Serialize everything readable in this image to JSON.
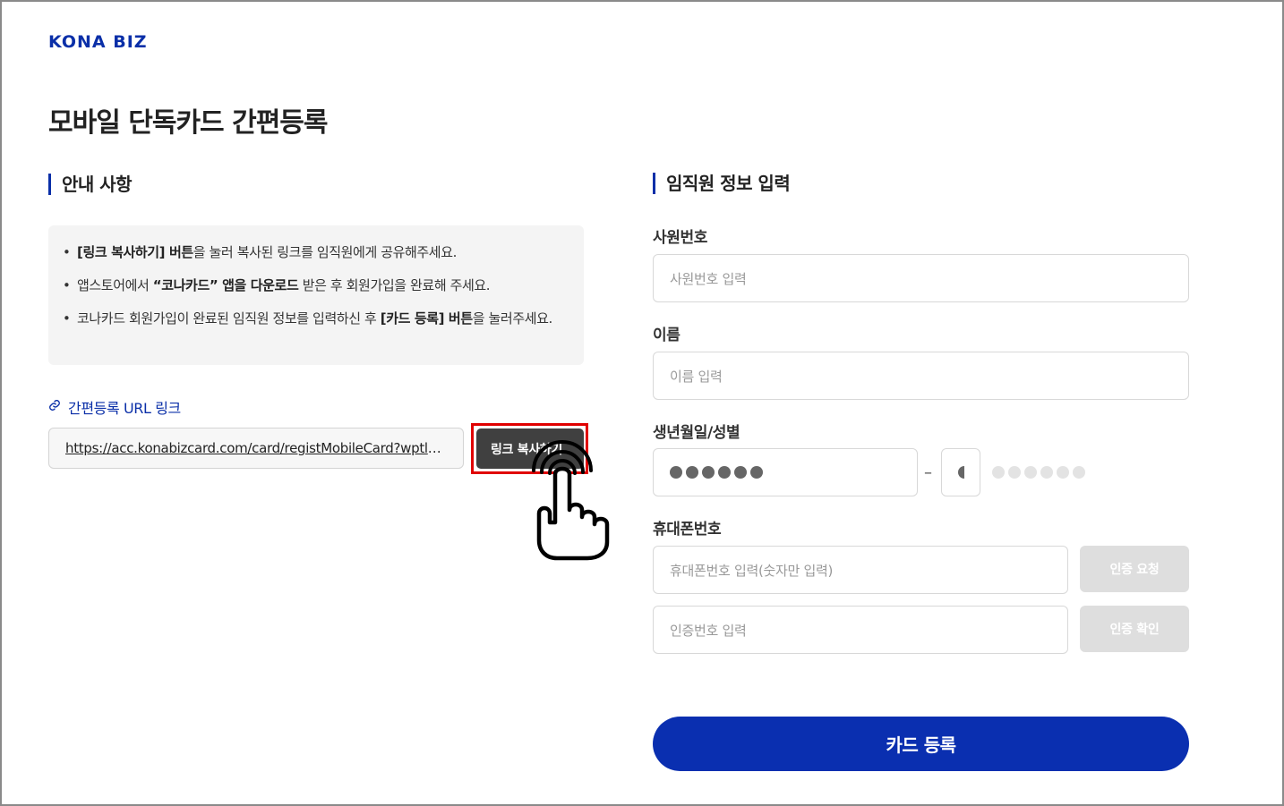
{
  "header": {
    "logo": "KONA BIZ"
  },
  "page": {
    "title": "모바일 단독카드 간편등록"
  },
  "guide": {
    "title": "안내 사항",
    "items": [
      {
        "bold": "[링크 복사하기] 버튼",
        "text": "을 눌러 복사된 링크를 임직원에게 공유해주세요."
      },
      {
        "pre": "앱스토어에서 ",
        "bold": "“코나카드” 앱을 다운로드",
        "text": " 받은 후 회원가입을 완료해 주세요."
      },
      {
        "pre": "코나카드 회원가입이 완료된 임직원 정보를 입력하신 후 ",
        "bold": "[카드 등록] 버튼",
        "text": "을 눌러주세요."
      }
    ],
    "url_label": "간편등록 URL 링크",
    "url_value": "https://acc.konabizcard.com/card/registMobileCard?wptlE…",
    "copy_button": "링크 복사하기"
  },
  "form": {
    "title": "임직원 정보 입력",
    "employee_no": {
      "label": "사원번호",
      "placeholder": "사원번호 입력"
    },
    "name": {
      "label": "이름",
      "placeholder": "이름 입력"
    },
    "birth": {
      "label": "생년월일/성별",
      "separator": "–"
    },
    "phone": {
      "label": "휴대폰번호",
      "placeholder": "휴대폰번호 입력(숫자만 입력)",
      "request_button": "인증 요청"
    },
    "auth": {
      "placeholder": "인증번호 입력",
      "confirm_button": "인증 확인"
    },
    "register_button": "카드 등록"
  },
  "icons": {
    "link": "link-icon",
    "pointer": "pointing-hand-icon"
  },
  "colors": {
    "brand": "#0a2fb0",
    "highlight": "#e00000"
  }
}
